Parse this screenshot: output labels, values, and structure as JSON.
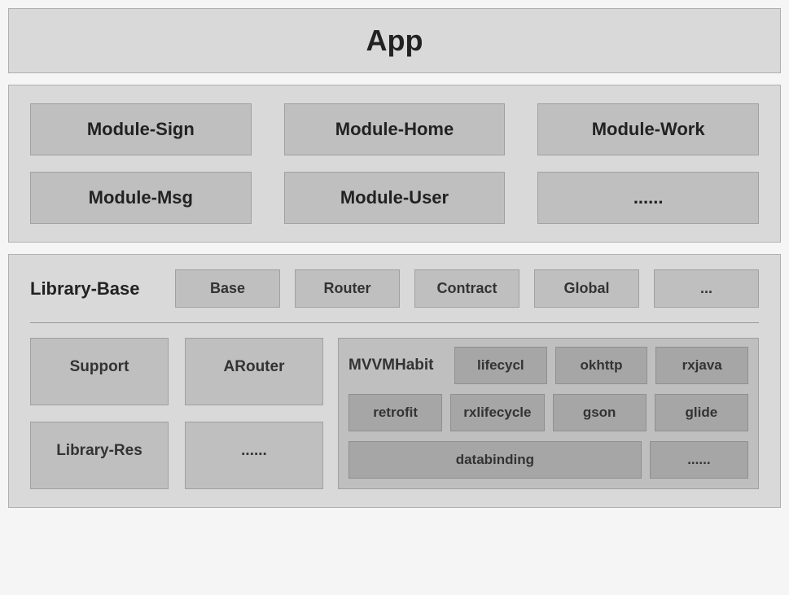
{
  "app": {
    "title": "App"
  },
  "modules": [
    "Module-Sign",
    "Module-Home",
    "Module-Work",
    "Module-Msg",
    "Module-User",
    "......"
  ],
  "library": {
    "base": {
      "title": "Library-Base",
      "items": [
        "Base",
        "Router",
        "Contract",
        "Global",
        "..."
      ]
    },
    "left": [
      "Support",
      "ARouter",
      "Library-Res",
      "......"
    ],
    "mvvm": {
      "title": "MVVMHabit",
      "row1": [
        "lifecycl",
        "okhttp",
        "rxjava"
      ],
      "row2": [
        "retrofit",
        "rxlifecycle",
        "gson",
        "glide"
      ],
      "row3": [
        "databinding",
        "......"
      ]
    }
  }
}
